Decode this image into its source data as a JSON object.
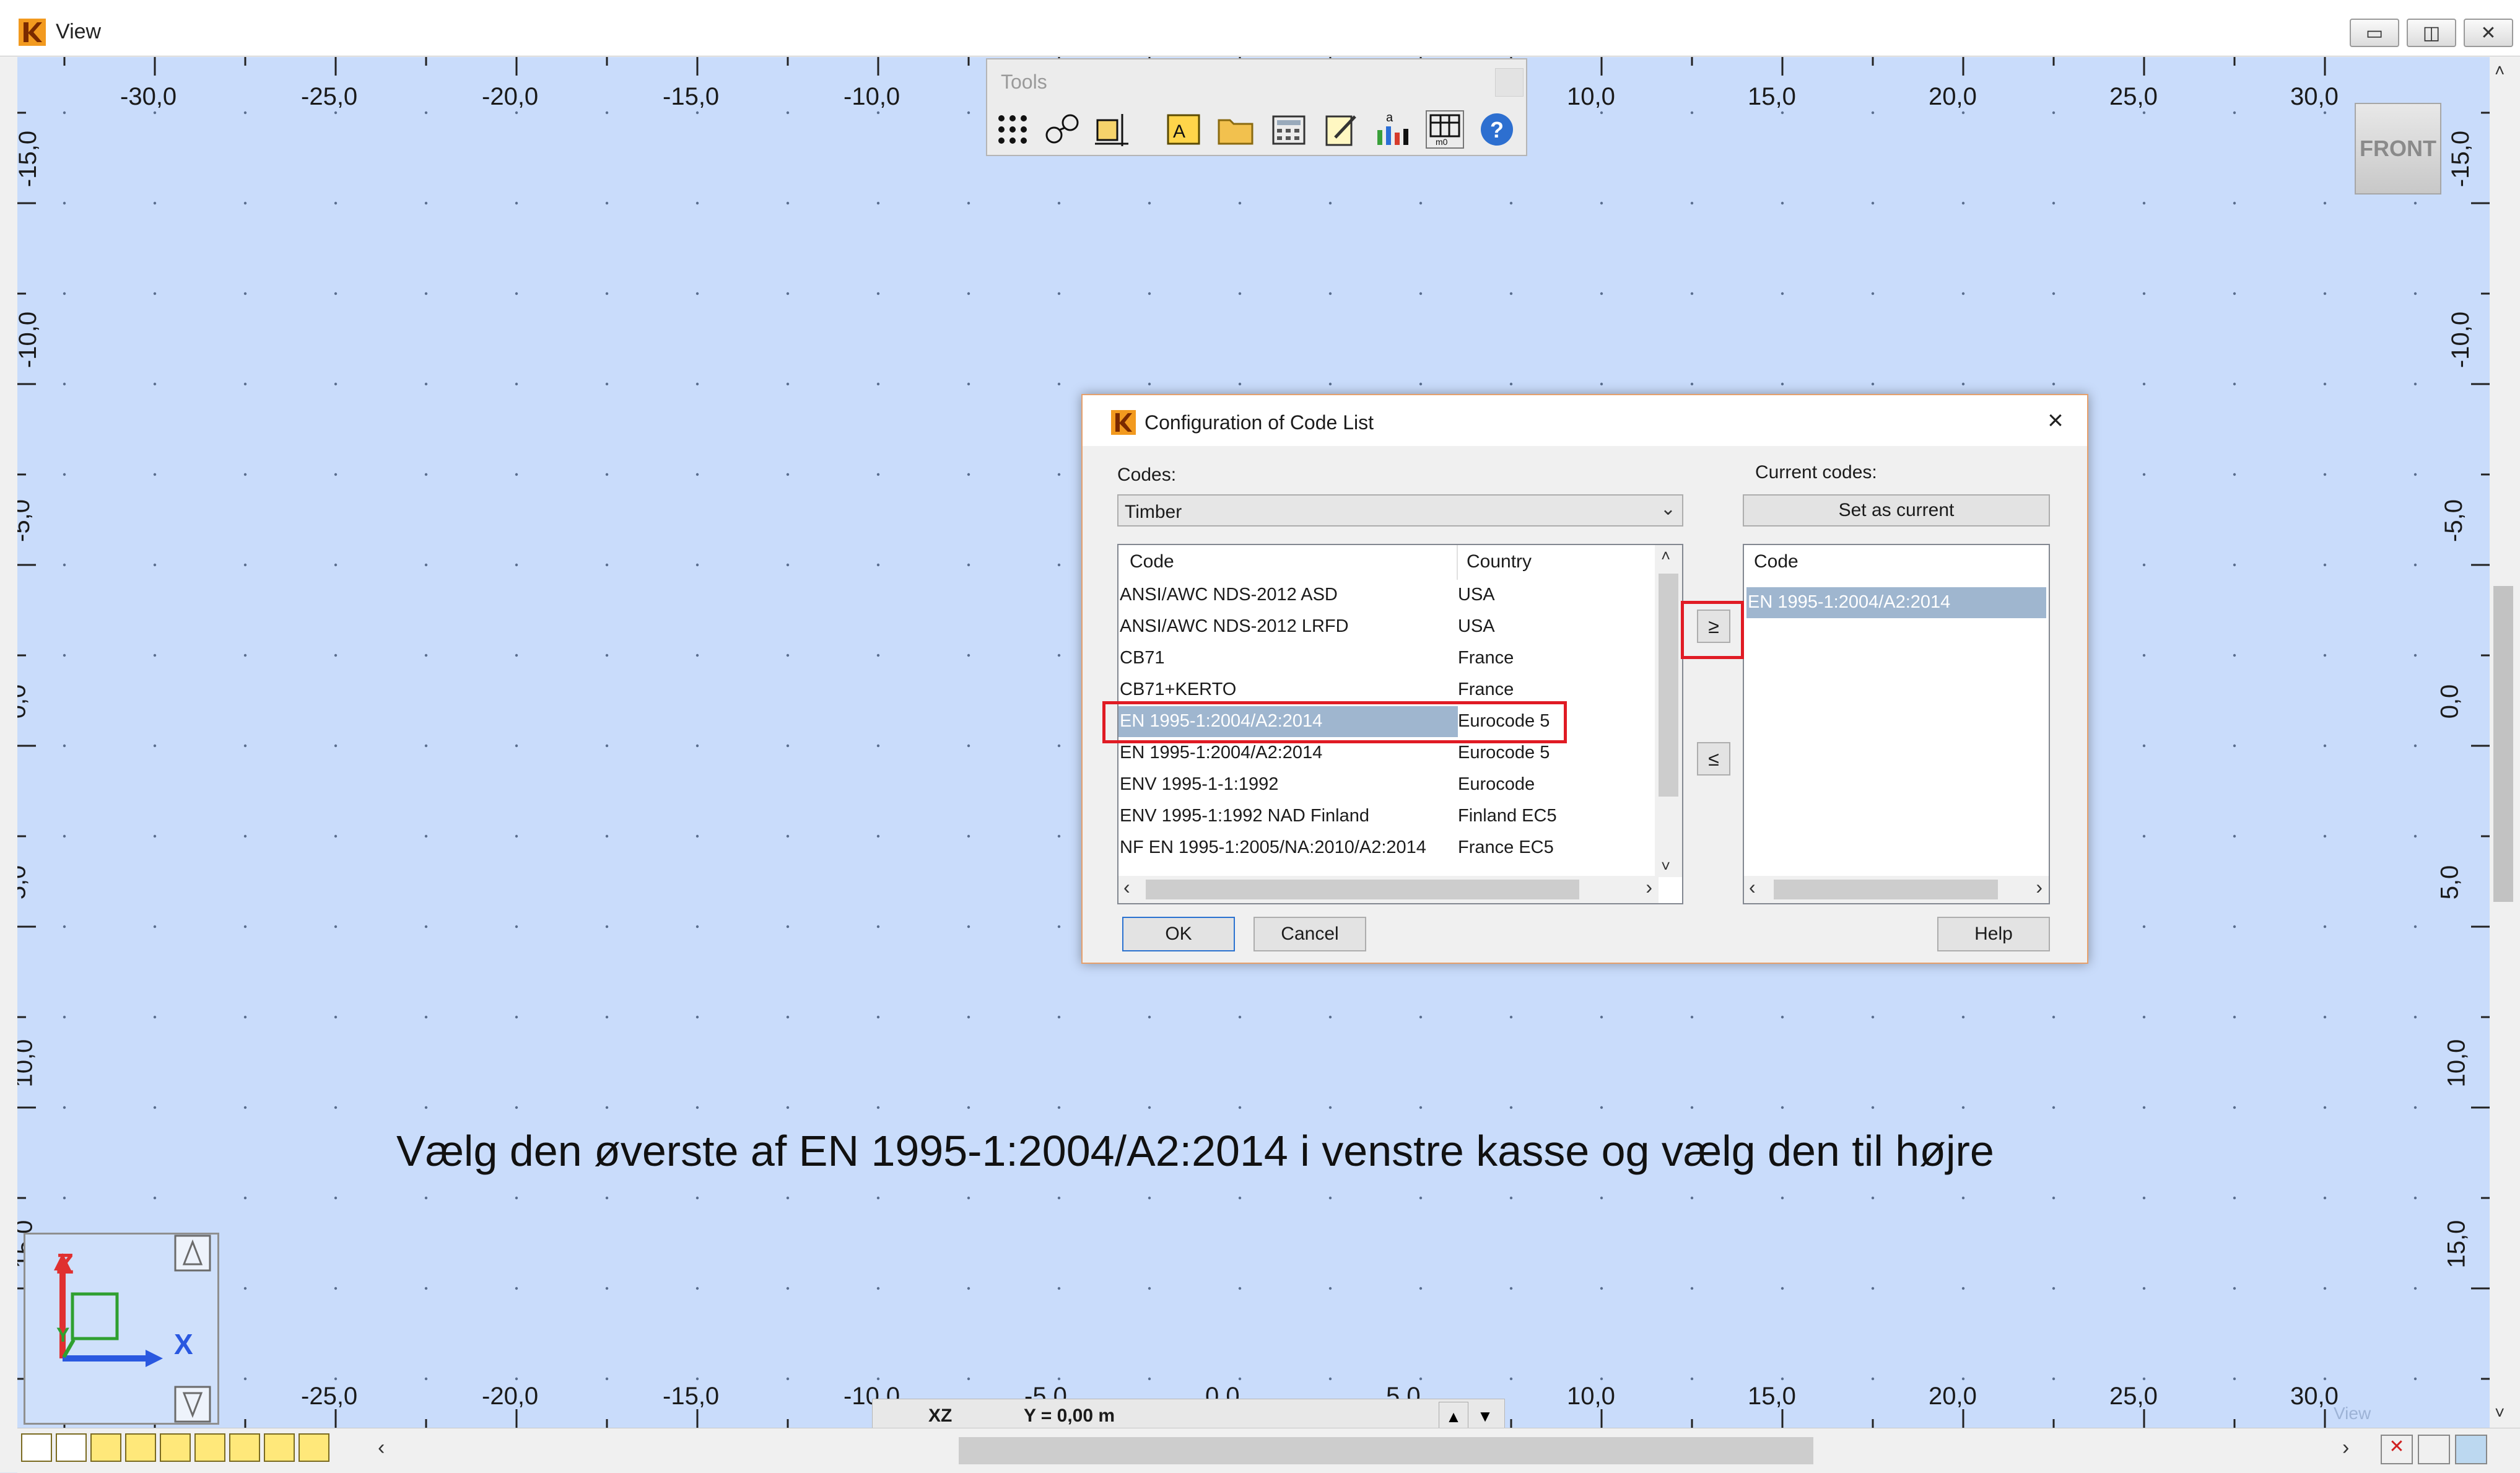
{
  "window": {
    "title": "View",
    "min_label": "▭",
    "max_label": "◫",
    "close_label": "✕"
  },
  "tools": {
    "title": "Tools",
    "icons": [
      "grid-dots-icon",
      "section-icon",
      "dimension-icon",
      "text-icon",
      "folder-icon",
      "calculator-icon",
      "edit-icon",
      "bar-chart-icon",
      "table-icon",
      "help-icon"
    ]
  },
  "view_cube": {
    "label": "FRONT"
  },
  "ruler": {
    "top_labels": [
      "-30,0",
      "-25,0",
      "-20,0",
      "-15,0",
      "-10,0",
      "-5,0",
      "0,0",
      "5,0",
      "10,0",
      "15,0",
      "20,0",
      "25,0",
      "30,0"
    ],
    "left_labels": [
      "15,0",
      "10,0",
      "5,0",
      "0,0",
      "-5,0",
      "-10,0",
      "-15,0"
    ]
  },
  "caption": "Vælg den øverste af EN 1995-1:2004/A2:2014 i venstre kasse og vælg den til højre",
  "statusbar": {
    "plane": "XZ",
    "coordinate": "Y = 0,00 m",
    "corner_label": "View"
  },
  "axis_gizmo": {
    "x_label": "X",
    "y_label": "Y",
    "z_label": "Z"
  },
  "dialog": {
    "title": "Configuration of Code List",
    "codes_label": "Codes:",
    "codes_value": "Timber",
    "current_codes_label": "Current codes:",
    "set_as_current": "Set as current",
    "left_headers": {
      "code": "Code",
      "country": "Country"
    },
    "rows": [
      {
        "code": "ANSI/AWC NDS-2012 ASD",
        "country": "USA"
      },
      {
        "code": "ANSI/AWC NDS-2012 LRFD",
        "country": "USA"
      },
      {
        "code": "CB71",
        "country": "France"
      },
      {
        "code": "CB71+KERTO",
        "country": "France"
      },
      {
        "code": "EN 1995-1:2004/A2:2014",
        "country": "Eurocode 5"
      },
      {
        "code": "EN 1995-1:2004/A2:2014",
        "country": "Eurocode 5"
      },
      {
        "code": "ENV 1995-1-1:1992",
        "country": "Eurocode"
      },
      {
        "code": "ENV 1995-1:1992 NAD Finland",
        "country": "Finland EC5"
      },
      {
        "code": "NF EN 1995-1:2005/NA:2010/A2:2014",
        "country": "France EC5"
      }
    ],
    "selected_row": 4,
    "add_button": "≥",
    "remove_button": "≤",
    "right_header": "Code",
    "current": [
      "EN 1995-1:2004/A2:2014"
    ],
    "ok": "OK",
    "cancel": "Cancel",
    "help": "Help"
  },
  "colors": {
    "viewport": "#c9dcfb",
    "highlight": "#e01b24",
    "selection": "#9fb6cf"
  }
}
